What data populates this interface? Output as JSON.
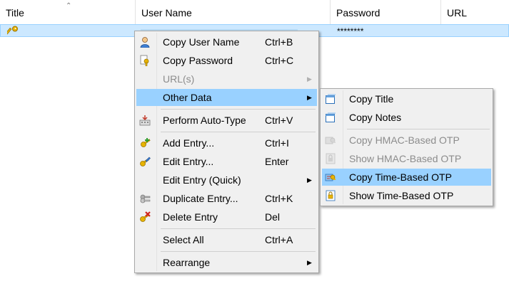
{
  "columns": {
    "title": "Title",
    "username": "User Name",
    "password": "Password",
    "url": "URL"
  },
  "selected_row": {
    "password": "********"
  },
  "context_menu": {
    "copy_user_name": {
      "label": "Copy User Name",
      "shortcut": "Ctrl+B",
      "icon": "user-icon"
    },
    "copy_password": {
      "label": "Copy Password",
      "shortcut": "Ctrl+C",
      "icon": "key-copy-icon"
    },
    "urls": {
      "label": "URL(s)",
      "icon": "submenu-arrow"
    },
    "other_data": {
      "label": "Other Data"
    },
    "perform_auto_type": {
      "label": "Perform Auto-Type",
      "shortcut": "Ctrl+V",
      "icon": "auto-type-icon"
    },
    "add_entry": {
      "label": "Add Entry...",
      "shortcut": "Ctrl+I",
      "icon": "add-key-icon"
    },
    "edit_entry": {
      "label": "Edit Entry...",
      "shortcut": "Enter",
      "icon": "edit-key-icon"
    },
    "edit_entry_quick": {
      "label": "Edit Entry (Quick)"
    },
    "duplicate_entry": {
      "label": "Duplicate Entry...",
      "shortcut": "Ctrl+K",
      "icon": "duplicate-keys-icon"
    },
    "delete_entry": {
      "label": "Delete Entry",
      "shortcut": "Del",
      "icon": "delete-key-icon"
    },
    "select_all": {
      "label": "Select All",
      "shortcut": "Ctrl+A"
    },
    "rearrange": {
      "label": "Rearrange"
    }
  },
  "other_data_submenu": {
    "copy_title": {
      "label": "Copy Title",
      "icon": "window-copy-icon"
    },
    "copy_notes": {
      "label": "Copy Notes",
      "icon": "window-copy-icon"
    },
    "copy_hotp": {
      "label": "Copy HMAC-Based OTP",
      "icon": "otp-copy-icon"
    },
    "show_hotp": {
      "label": "Show HMAC-Based OTP",
      "icon": "otp-show-icon"
    },
    "copy_totp": {
      "label": "Copy Time-Based OTP",
      "icon": "otp-copy-icon"
    },
    "show_totp": {
      "label": "Show Time-Based OTP",
      "icon": "otp-show-icon"
    }
  },
  "colors": {
    "menu_bg": "#f0f0f0",
    "highlight": "#99d1ff",
    "selected_row": "#cce8ff",
    "disabled_text": "#8c8c8c"
  }
}
